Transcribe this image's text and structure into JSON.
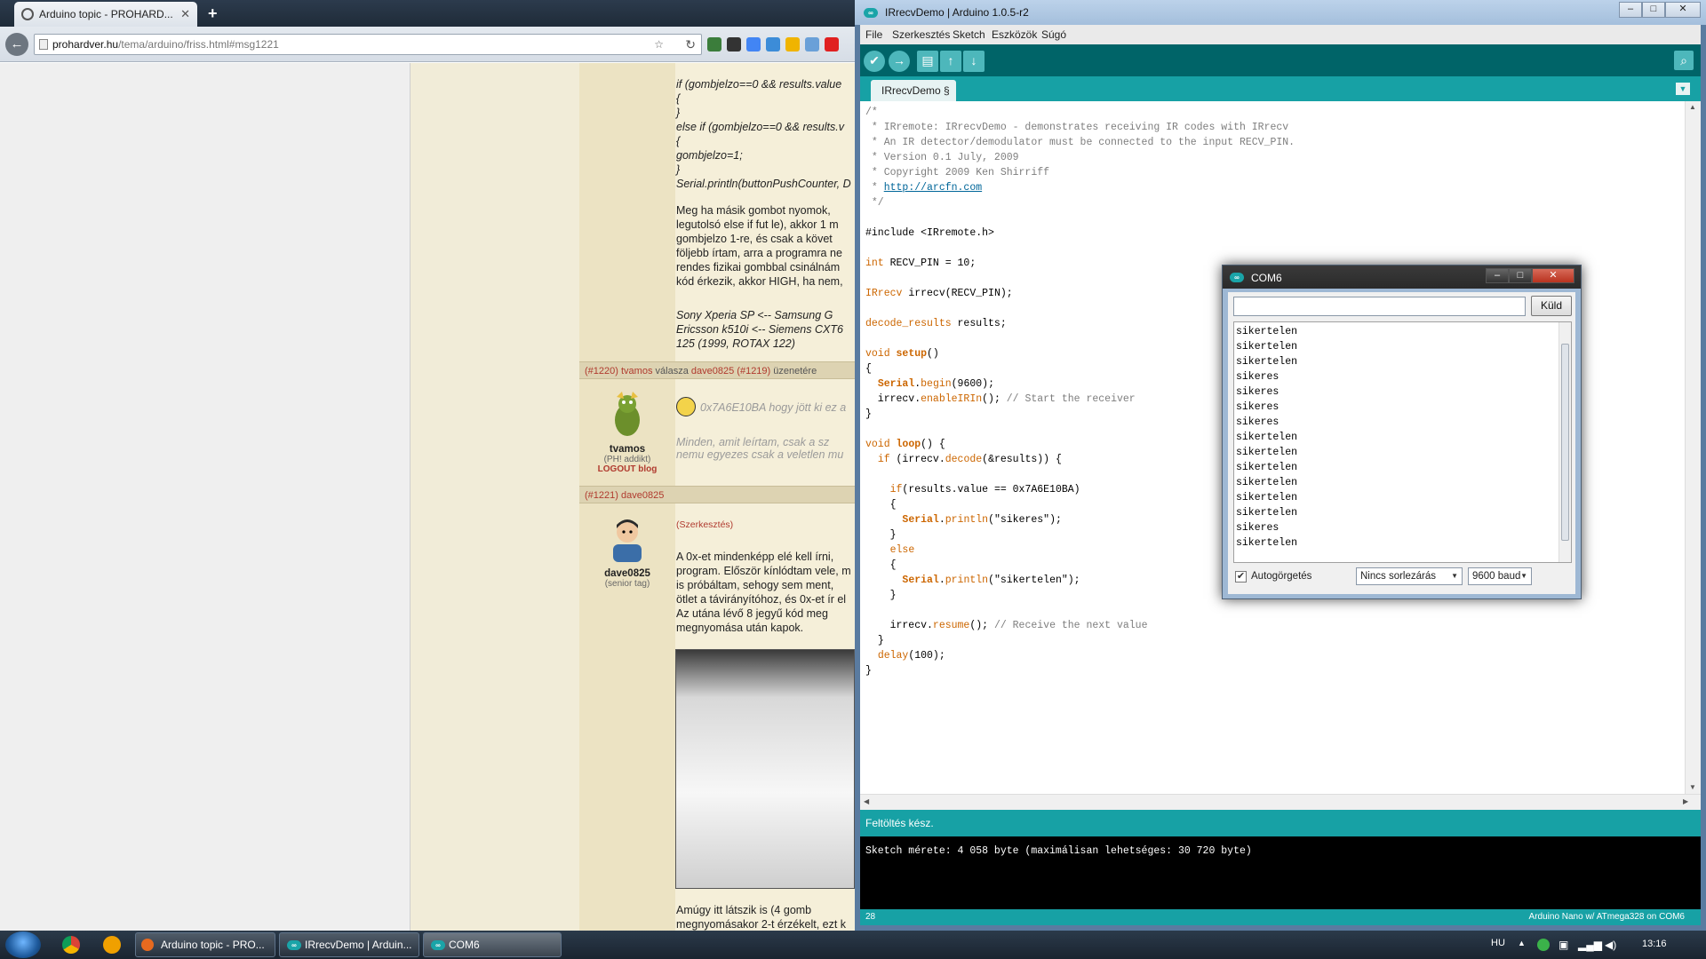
{
  "browser": {
    "tab_title": "Arduino topic - PROHARD...",
    "url_host": "prohardver.hu",
    "url_path": "/tema/arduino/friss.html#msg1221",
    "forum": {
      "code_lines": [
        "if (gombjelzo==0 && results.value",
        "{",
        "}",
        "else if (gombjelzo==0 && results.v",
        "{",
        "gombjelzo=1;",
        "}",
        "Serial.println(buttonPushCounter, D"
      ],
      "para1": [
        "Meg ha másik gombot nyomok,",
        "legutolsó else if fut le), akkor 1 m",
        "gombjelzo 1-re, és csak a követ",
        "följebb írtam, arra a programra ne",
        "rendes fizikai gombbal csinálnám",
        "kód érkezik, akkor HIGH, ha nem,"
      ],
      "signature": [
        "Sony Xperia SP <-- Samsung G",
        "Ericsson k510i <-- Siemens CXT6",
        "125 (1999, ROTAX 122)"
      ],
      "post1": {
        "id": "#1220",
        "user": "tvamos",
        "reply_text": "válasza",
        "reply_to": "dave0825",
        "reply_id": "#1219",
        "suffix": "üzenetére",
        "rank": "(PH! addikt)",
        "blog": "LOGOUT blog",
        "quote": "0x7A6E10BA hogy jött ki ez a",
        "body": [
          "Minden, amit leírtam, csak a sz",
          "nemu egyezes csak a veletlen mu"
        ]
      },
      "post2": {
        "id": "#1221",
        "user": "dave0825",
        "rank": "(senior tag)",
        "edit": "(Szerkesztés)",
        "body": [
          "A 0x-et mindenképp elé kell írni,",
          "program. Először kínlódtam vele, m",
          "is próbáltam, sehogy sem ment,",
          "ötlet a távirányítóhoz, és 0x-et ír el",
          "Az utána lévő 8 jegyű kód meg",
          "megnyomása után kapok."
        ],
        "footer": [
          "Amúgy itt látszik is (4 gomb",
          "megnyomásakor 2-t érzékelt, ezt k"
        ]
      }
    }
  },
  "ide": {
    "title": "IRrecvDemo | Arduino 1.0.5-r2",
    "menu": [
      "File",
      "Szerkesztés",
      "Sketch",
      "Eszközök",
      "Súgó"
    ],
    "tab_label": "IRrecvDemo §",
    "code": {
      "c1": "/*",
      "c2": " * IRremote: IRrecvDemo - demonstrates receiving IR codes with IRrecv",
      "c3": " * An IR detector/demodulator must be connected to the input RECV_PIN.",
      "c4": " * Version 0.1 July, 2009",
      "c5": " * Copyright 2009 Ken Shirriff",
      "c6_prefix": " * ",
      "c6_link": "http://arcfn.com",
      "c7": " */",
      "include": "#include <IRremote.h>",
      "int_kw": "int",
      "int_rest": " RECV_PIN = 10;",
      "irrecv_kw": "IRrecv",
      "irrecv_rest": " irrecv(RECV_PIN);",
      "decode_kw": "decode_results",
      "decode_rest": " results;",
      "void": "void",
      "setup": "setup",
      "paren_open": "()",
      "brace_open": "{",
      "serial": "Serial",
      "dot": ".",
      "begin": "begin",
      "begin_args": "(9600);",
      "irrecv_obj": "  irrecv.",
      "enable": "enableIRIn",
      "enable_rest": "(); ",
      "enable_cm": "// Start the receiver",
      "brace_close": "}",
      "loop": "loop",
      "loop_rest": "() {",
      "if_kw": "if",
      "if_pre": " (irrecv.",
      "decode_fn": "decode",
      "decode_args": "(&results)) {",
      "if2_rest": "(results.value == 0x7A6E10BA)",
      "println": "println",
      "str_ok": "(\"sikeres\");",
      "else_kw": "else",
      "str_fail": "(\"sikertelen\");",
      "resume_pre": "    irrecv.",
      "resume": "resume",
      "resume_rest": "(); ",
      "resume_cm": "// Receive the next value",
      "delay": "delay",
      "delay_args": "(100);"
    },
    "status": "Feltöltés kész.",
    "console": "Sketch mérete: 4 058 byte (maximálisan lehetséges: 30 720 byte)",
    "line_number": "28",
    "board": "Arduino Nano w/ ATmega328 on COM6"
  },
  "serial": {
    "title": "COM6",
    "input_value": "",
    "send_label": "Küld",
    "lines": [
      "sikertelen",
      "sikertelen",
      "sikertelen",
      "sikeres",
      "sikeres",
      "sikeres",
      "sikeres",
      "sikertelen",
      "sikertelen",
      "sikertelen",
      "sikertelen",
      "sikertelen",
      "sikertelen",
      "sikeres",
      "sikertelen"
    ],
    "autoscroll_label": "Autogörgetés",
    "autoscroll_checked": true,
    "line_ending": "Nincs sorlezárás",
    "baud": "9600 baud"
  },
  "taskbar": {
    "tasks": [
      "Arduino topic - PRO...",
      "IRrecvDemo | Arduin...",
      "COM6"
    ],
    "lang": "HU",
    "clock": "13:16"
  },
  "colors": {
    "arduino_teal": "#17a1a5",
    "arduino_dark": "#006468",
    "forum_bg": "#ece3c3",
    "link_red": "#b03a2e"
  }
}
